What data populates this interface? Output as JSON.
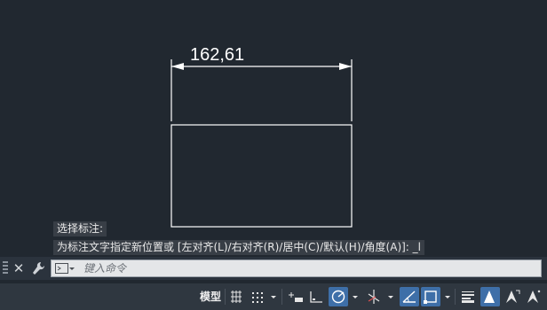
{
  "drawing": {
    "dimension_text": "162,61"
  },
  "command_history": [
    "选择标注:",
    "为标注文字指定新位置或 [左对齐(L)/右对齐(R)/居中(C)/默认(H)/角度(A)]: _l"
  ],
  "command_line": {
    "placeholder": "键入命令"
  },
  "status_bar": {
    "model_label": "模型",
    "items": [
      "grid-icon",
      "snap-icon",
      "dropdown-icon",
      "infer-constraints-icon",
      "ortho-icon",
      "polar-tracking-icon",
      "dropdown-icon",
      "isodraft-icon",
      "dropdown-icon",
      "object-snap-tracking-icon",
      "object-snap-icon",
      "dropdown-icon",
      "lineweight-icon",
      "annotation-visibility-icon",
      "auto-scale-icon",
      "annotation-scale-icon"
    ]
  },
  "colors": {
    "background": "#212830",
    "geometry": "#ffffff",
    "active_toggle": "#3e6fa8"
  }
}
